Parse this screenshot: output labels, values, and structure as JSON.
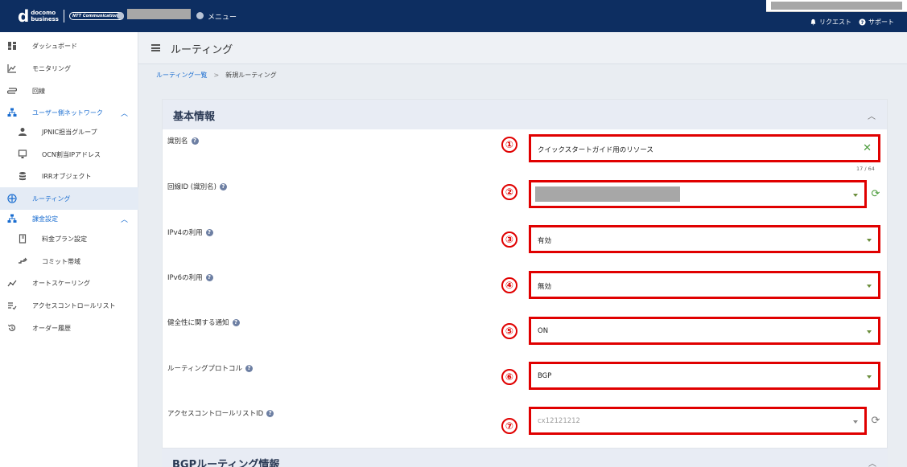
{
  "header": {
    "logo_line1": "docomo",
    "logo_line2": "business",
    "partner_logo": "NTT Communications",
    "menu_label": "メニュー",
    "request_label": "リクエスト",
    "support_label": "サポート"
  },
  "sidebar": {
    "items": [
      {
        "label": "ダッシュボード",
        "icon": "dashboard-icon"
      },
      {
        "label": "モニタリング",
        "icon": "chart-line-icon"
      },
      {
        "label": "回線",
        "icon": "circuit-icon"
      },
      {
        "label": "ユーザー側ネットワーク",
        "icon": "network-icon"
      },
      {
        "label": "JPNIC担当グループ",
        "icon": "person-icon"
      },
      {
        "label": "OCN割当IPアドレス",
        "icon": "monitor-icon"
      },
      {
        "label": "IRRオブジェクト",
        "icon": "database-icon"
      },
      {
        "label": "ルーティング",
        "icon": "routing-icon"
      },
      {
        "label": "課金設定",
        "icon": "billing-network-icon"
      },
      {
        "label": "料金プラン設定",
        "icon": "notebook-icon"
      },
      {
        "label": "コミット帯域",
        "icon": "bandwidth-icon"
      },
      {
        "label": "オートスケーリング",
        "icon": "autoscale-icon"
      },
      {
        "label": "アクセスコントロールリスト",
        "icon": "checklist-icon"
      },
      {
        "label": "オーダー履歴",
        "icon": "history-icon"
      }
    ]
  },
  "page": {
    "title": "ルーティング",
    "breadcrumb_parent": "ルーティング一覧",
    "breadcrumb_sep": ">",
    "breadcrumb_current": "新規ルーティング"
  },
  "form": {
    "section_title": "基本情報",
    "next_section_title": "BGPルーティング情報",
    "fields": [
      {
        "marker": "①",
        "label": "識別名",
        "value": "クイックスタートガイド用のリソース",
        "counter": "17 / 64"
      },
      {
        "marker": "②",
        "label": "回線ID (識別名)",
        "value": ""
      },
      {
        "marker": "③",
        "label": "IPv4の利用",
        "value": "有効"
      },
      {
        "marker": "④",
        "label": "IPv6の利用",
        "value": "無効"
      },
      {
        "marker": "⑤",
        "label": "健全性に関する通知",
        "value": "ON"
      },
      {
        "marker": "⑥",
        "label": "ルーティングプロトコル",
        "value": "BGP"
      },
      {
        "marker": "⑦",
        "label": "アクセスコントロールリストID",
        "value": "cx12121212"
      }
    ]
  },
  "colors": {
    "header_bg": "#0d2e61",
    "highlight_red": "#e00000",
    "link_blue": "#1a6dd0",
    "active_bg": "#e4ebf5"
  }
}
